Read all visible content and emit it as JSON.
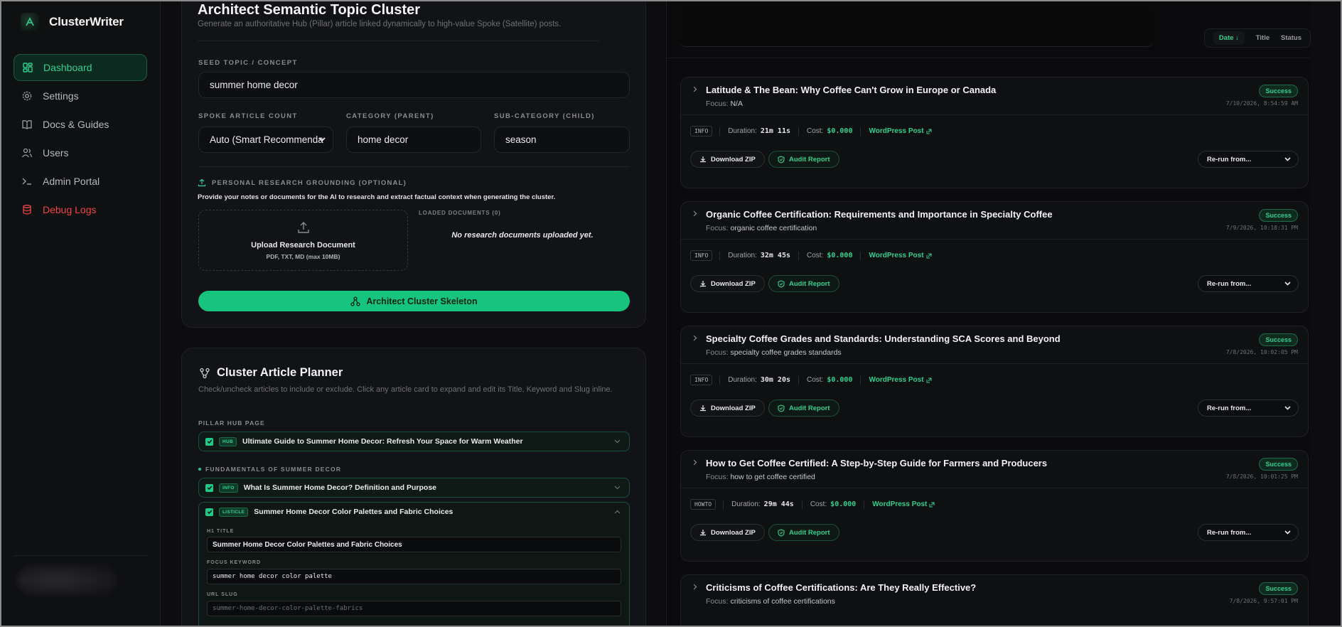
{
  "app": {
    "name": "ClusterWriter"
  },
  "sidebar": {
    "items": [
      {
        "label": "Dashboard",
        "icon": "dashboard-icon",
        "active": true
      },
      {
        "label": "Settings",
        "icon": "gear-icon"
      },
      {
        "label": "Docs & Guides",
        "icon": "book-icon"
      },
      {
        "label": "Users",
        "icon": "users-icon"
      },
      {
        "label": "Admin Portal",
        "icon": "terminal-icon"
      },
      {
        "label": "Debug Logs",
        "icon": "database-icon",
        "danger": true
      }
    ]
  },
  "architect": {
    "title": "Architect Semantic Topic Cluster",
    "subtitle": "Generate an authoritative Hub (Pillar) article linked dynamically to high-value Spoke (Satellite) posts.",
    "seed_label": "SEED TOPIC / CONCEPT",
    "seed_value": "summer home decor",
    "spoke_label": "SPOKE ARTICLE COUNT",
    "spoke_value": "Auto (Smart Recommenda",
    "category_label": "CATEGORY (PARENT)",
    "category_value": "home decor",
    "subcategory_label": "SUB-CATEGORY (CHILD)",
    "subcategory_value": "season",
    "research_label": "PERSONAL RESEARCH GROUNDING (OPTIONAL)",
    "research_desc": "Provide your notes or documents for the AI to research and extract factual context when generating the cluster.",
    "upload_title": "Upload Research Document",
    "upload_sub": "PDF, TXT, MD (max 10MB)",
    "loaded_label": "LOADED DOCUMENTS (0)",
    "no_docs": "No research documents uploaded yet.",
    "cta": "Architect Cluster Skeleton"
  },
  "planner": {
    "title": "Cluster Article Planner",
    "desc": "Check/uncheck articles to include or exclude. Click any article card to expand and edit its Title, Keyword and Slug inline.",
    "pillar_label": "PILLAR HUB PAGE",
    "pillar": {
      "tag": "HUB",
      "title": "Ultimate Guide to Summer Home Decor: Refresh Your Space for Warm Weather"
    },
    "group_label": "FUNDAMENTALS OF SUMMER DECOR",
    "item1": {
      "tag": "INFO",
      "title": "What Is Summer Home Decor? Definition and Purpose"
    },
    "item2": {
      "tag": "LISTICLE",
      "title": "Summer Home Decor Color Palettes and Fabric Choices",
      "h1_label": "H1 TITLE",
      "h1_value": "Summer Home Decor Color Palettes and Fabric Choices",
      "kw_label": "FOCUS KEYWORD",
      "kw_value": "summer home decor color palette",
      "slug_label": "URL SLUG",
      "slug_value": "summer-home-decor-color-palette-fabrics"
    }
  },
  "history": {
    "sort": {
      "date": "Date ↓",
      "title": "Title",
      "status": "Status"
    },
    "cards": [
      {
        "title": "Latitude & The Bean: Why Coffee Can't Grow in Europe or Canada",
        "focus_label": "Focus:",
        "focus": "N/A",
        "status": "Success",
        "date": "7/10/2026, 8:54:59 AM",
        "type": "INFO",
        "duration_label": "Duration:",
        "duration": "21m 11s",
        "cost_label": "Cost:",
        "cost": "$0.000",
        "wp": "WordPress Post",
        "download": "Download ZIP",
        "audit": "Audit Report",
        "rerun": "Re-run from..."
      },
      {
        "title": "Organic Coffee Certification: Requirements and Importance in Specialty Coffee",
        "focus_label": "Focus:",
        "focus": "organic coffee certification",
        "status": "Success",
        "date": "7/9/2026, 10:18:31 PM",
        "type": "INFO",
        "duration_label": "Duration:",
        "duration": "32m 45s",
        "cost_label": "Cost:",
        "cost": "$0.000",
        "wp": "WordPress Post",
        "download": "Download ZIP",
        "audit": "Audit Report",
        "rerun": "Re-run from..."
      },
      {
        "title": "Specialty Coffee Grades and Standards: Understanding SCA Scores and Beyond",
        "focus_label": "Focus:",
        "focus": "specialty coffee grades standards",
        "status": "Success",
        "date": "7/8/2026, 10:02:05 PM",
        "type": "INFO",
        "duration_label": "Duration:",
        "duration": "30m 20s",
        "cost_label": "Cost:",
        "cost": "$0.000",
        "wp": "WordPress Post",
        "download": "Download ZIP",
        "audit": "Audit Report",
        "rerun": "Re-run from..."
      },
      {
        "title": "How to Get Coffee Certified: A Step-by-Step Guide for Farmers and Producers",
        "focus_label": "Focus:",
        "focus": "how to get coffee certified",
        "status": "Success",
        "date": "7/8/2026, 10:01:25 PM",
        "type": "HOWTO",
        "duration_label": "Duration:",
        "duration": "29m 44s",
        "cost_label": "Cost:",
        "cost": "$0.000",
        "wp": "WordPress Post",
        "download": "Download ZIP",
        "audit": "Audit Report",
        "rerun": "Re-run from..."
      },
      {
        "title": "Criticisms of Coffee Certifications: Are They Really Effective?",
        "focus_label": "Focus:",
        "focus": "criticisms of coffee certifications",
        "status": "Success",
        "date": "7/8/2026, 9:57:01 PM"
      }
    ]
  }
}
